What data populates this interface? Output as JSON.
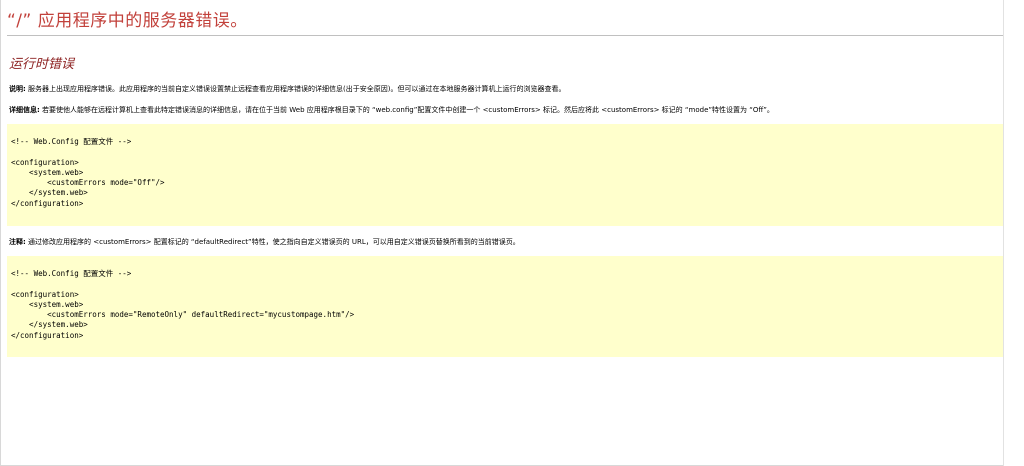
{
  "header": {
    "title": "“/” 应用程序中的服务器错误。"
  },
  "subheader": {
    "text": "运行时错误"
  },
  "description": {
    "label": "说明:",
    "text": " 服务器上出现应用程序错误。此应用程序的当前自定义错误设置禁止远程查看应用程序错误的详细信息(出于安全原因)。但可以通过在本地服务器计算机上运行的浏览器查看。"
  },
  "details": {
    "label": "详细信息:",
    "text": " 若要使他人能够在远程计算机上查看此特定错误消息的详细信息，请在位于当前 Web 应用程序根目录下的 “web.config”配置文件中创建一个 <customErrors> 标记。然后应将此 <customErrors> 标记的 “mode”特性设置为 “Off”。"
  },
  "code1": {
    "text": "<!-- Web.Config 配置文件 -->\n\n<configuration>\n    <system.web>\n        <customErrors mode=\"Off\"/>\n    </system.web>\n</configuration>"
  },
  "notes": {
    "label": "注释:",
    "text": " 通过修改应用程序的 <customErrors> 配置标记的 “defaultRedirect”特性，使之指向自定义错误页的 URL，可以用自定义错误页替换所看到的当前错误页。"
  },
  "code2": {
    "text": "<!-- Web.Config 配置文件 -->\n\n<configuration>\n    <system.web>\n        <customErrors mode=\"RemoteOnly\" defaultRedirect=\"mycustompage.htm\"/>\n    </system.web>\n</configuration>"
  },
  "colors": {
    "header": "#c2413b",
    "subheader": "#8b1e1e",
    "code_background": "#ffffcc"
  }
}
